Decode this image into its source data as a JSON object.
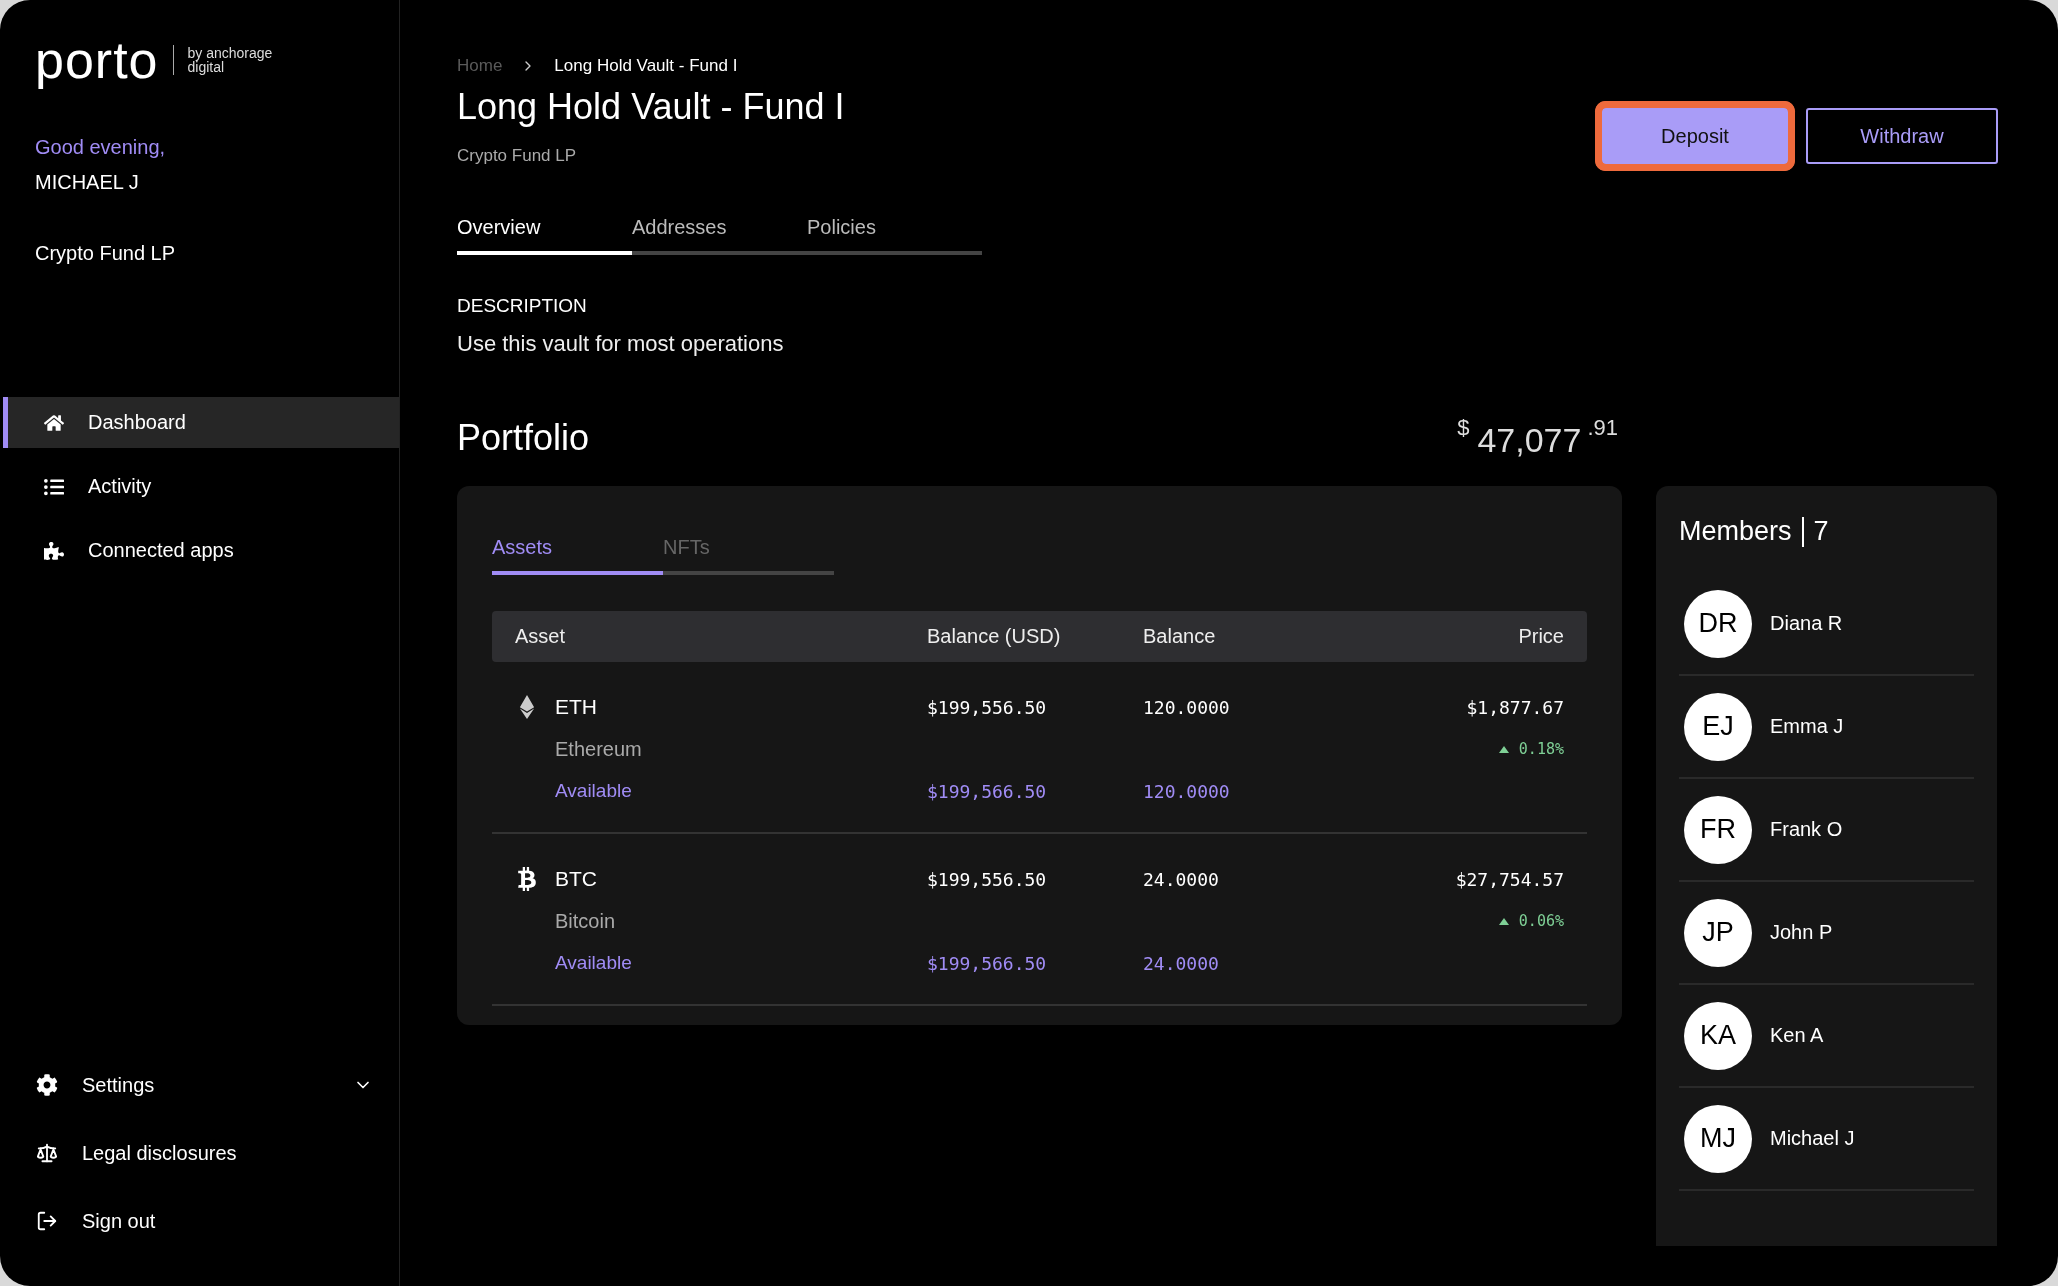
{
  "sidebar": {
    "logo": {
      "wordmark": "porto",
      "tagline": "by anchorage digital"
    },
    "greeting": "Good evening,",
    "user": "MICHAEL J",
    "organization": "Crypto Fund LP",
    "nav": [
      {
        "kind": "home",
        "label": "Dashboard",
        "selected": true
      },
      {
        "kind": "list",
        "label": "Activity",
        "selected": false
      },
      {
        "kind": "puzzle",
        "label": "Connected apps",
        "selected": false
      }
    ],
    "footer": [
      {
        "kind": "gear",
        "label": "Settings",
        "expanded": false
      },
      {
        "kind": "scale",
        "label": "Legal disclosures"
      },
      {
        "kind": "exit",
        "label": "Sign out"
      }
    ]
  },
  "breadcrumb": [
    "Home",
    "Long Hold Vault - Fund I"
  ],
  "title": "Long Hold Vault - Fund I",
  "subtitle": "Crypto Fund LP",
  "actions": [
    {
      "kind": "primary",
      "label": "Deposit",
      "highlighted": true
    },
    {
      "kind": "outline",
      "label": "Withdraw",
      "highlighted": false
    }
  ],
  "tabs": [
    {
      "label": "Overview",
      "selected": true
    },
    {
      "label": "Addresses",
      "selected": false
    },
    {
      "label": "Policies",
      "selected": false
    }
  ],
  "description": {
    "label": "DESCRIPTION",
    "text": "Use this vault for most operations"
  },
  "portfolio": {
    "title": "Portfolio",
    "total": {
      "currency": "$",
      "whole": "47,077",
      "cents": ".91"
    },
    "tabs": [
      {
        "label": "Assets",
        "selected": true
      },
      {
        "label": "NFTs",
        "selected": false
      }
    ],
    "table": {
      "columns": [
        "Asset",
        "Balance (USD)",
        "Balance",
        "Price"
      ],
      "rows": [
        {
          "kind": "eth",
          "symbol": "ETH",
          "name": "Ethereum",
          "balance_usd": "$199,556.50",
          "balance": "120.0000",
          "price": "$1,877.67",
          "change": "0.18%",
          "available_label": "Available",
          "available_usd": "$199,566.50",
          "available": "120.0000"
        },
        {
          "kind": "btc",
          "symbol": "BTC",
          "name": "Bitcoin",
          "balance_usd": "$199,556.50",
          "balance": "24.0000",
          "price": "$27,754.57",
          "change": "0.06%",
          "available_label": "Available",
          "available_usd": "$199,566.50",
          "available": "24.0000"
        }
      ]
    }
  },
  "members": {
    "title": "Members",
    "count": "7",
    "list": [
      {
        "initials": "DR",
        "name": "Diana R"
      },
      {
        "initials": "EJ",
        "name": "Emma J"
      },
      {
        "initials": "FR",
        "name": "Frank O"
      },
      {
        "initials": "JP",
        "name": "John P"
      },
      {
        "initials": "KA",
        "name": "Ken A"
      },
      {
        "initials": "MJ",
        "name": "Michael J"
      }
    ]
  }
}
